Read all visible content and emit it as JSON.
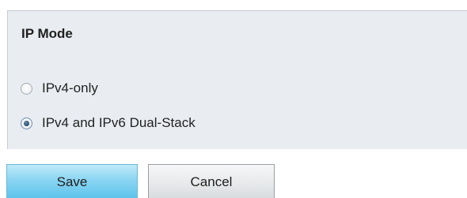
{
  "ip_mode": {
    "title": "IP Mode",
    "options": [
      {
        "label": "IPv4-only",
        "checked": false
      },
      {
        "label": "IPv4 and IPv6 Dual-Stack",
        "checked": true
      }
    ]
  },
  "actions": {
    "save_label": "Save",
    "cancel_label": "Cancel"
  },
  "colors": {
    "panel_background": "#e9edf1",
    "save_button": "#8bd5f2",
    "cancel_button": "#e6e8ea",
    "radio_checked_dot": "#25476b"
  }
}
